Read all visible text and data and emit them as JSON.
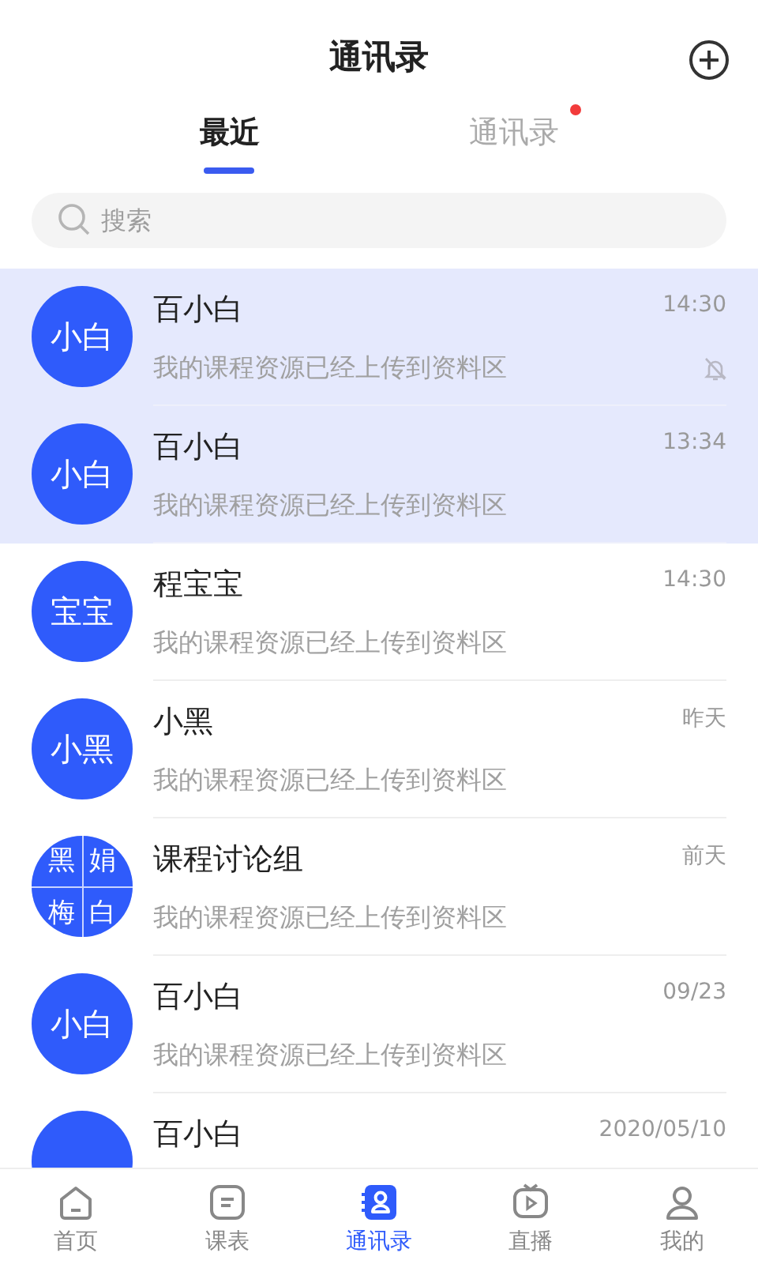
{
  "header": {
    "title": "通讯录"
  },
  "tabs": [
    {
      "label": "最近",
      "selected": true,
      "badge": false
    },
    {
      "label": "通讯录",
      "selected": false,
      "badge": true
    }
  ],
  "search": {
    "placeholder": "搜索"
  },
  "conversations": [
    {
      "avatar": [
        "小白"
      ],
      "name": "百小白",
      "message": "我的课程资源已经上传到资料区",
      "time": "14:30",
      "pinned": true,
      "muted": true
    },
    {
      "avatar": [
        "小白"
      ],
      "name": "百小白",
      "message": "我的课程资源已经上传到资料区",
      "time": "13:34",
      "pinned": true,
      "muted": false
    },
    {
      "avatar": [
        "宝宝"
      ],
      "name": "程宝宝",
      "message": "我的课程资源已经上传到资料区",
      "time": "14:30",
      "pinned": false,
      "muted": false
    },
    {
      "avatar": [
        "小黑"
      ],
      "name": "小黑",
      "message": "我的课程资源已经上传到资料区",
      "time": "昨天",
      "pinned": false,
      "muted": false
    },
    {
      "avatar": [
        "黑",
        "娟",
        "梅",
        "白"
      ],
      "name": "课程讨论组",
      "message": "我的课程资源已经上传到资料区",
      "time": "前天",
      "pinned": false,
      "muted": false
    },
    {
      "avatar": [
        "小白"
      ],
      "name": "百小白",
      "message": "我的课程资源已经上传到资料区",
      "time": "09/23",
      "pinned": false,
      "muted": false
    },
    {
      "name": "百小白",
      "time": "2020/05/10",
      "pinned": false,
      "muted": false
    }
  ],
  "nav": [
    {
      "label": "首页",
      "selected": false
    },
    {
      "label": "课表",
      "selected": false
    },
    {
      "label": "通讯录",
      "selected": true
    },
    {
      "label": "直播",
      "selected": false
    },
    {
      "label": "我的",
      "selected": false
    }
  ]
}
